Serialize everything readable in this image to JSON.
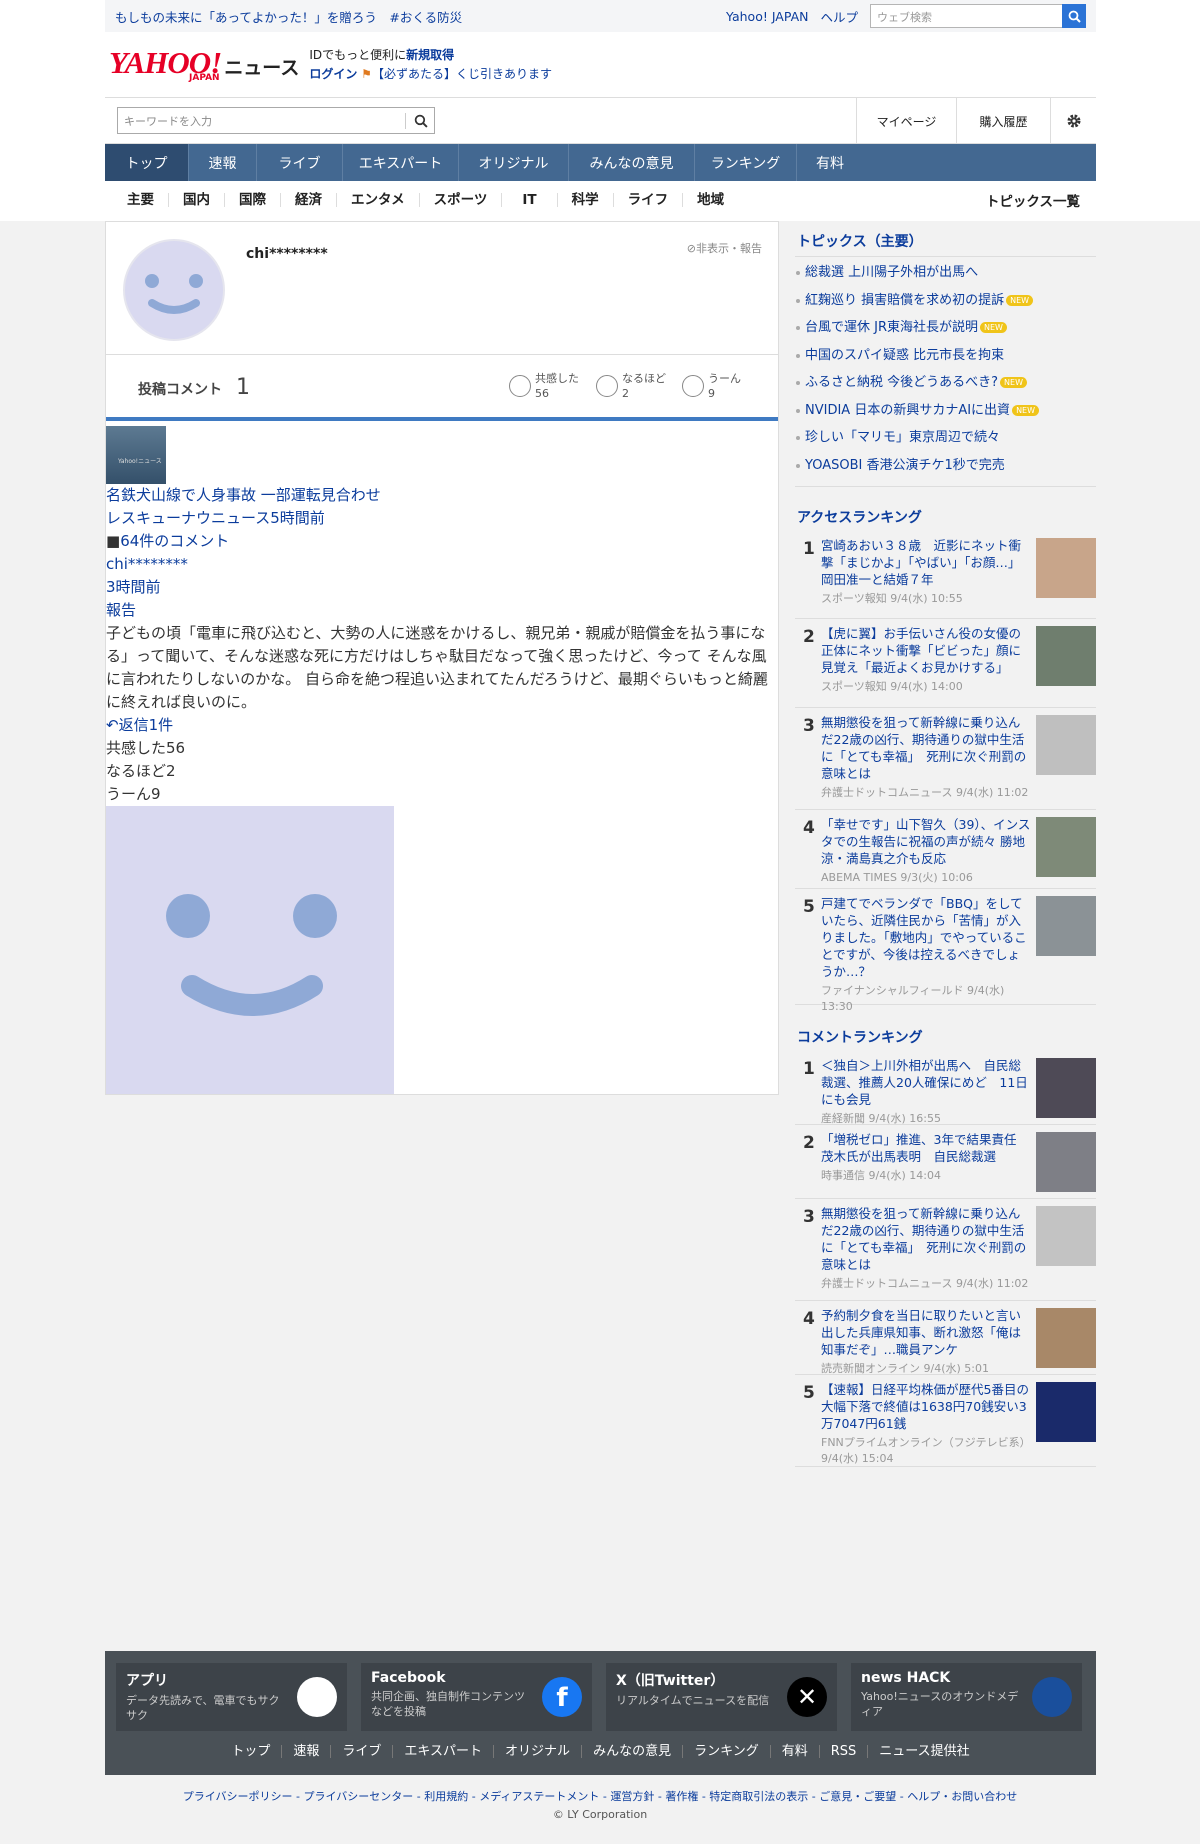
{
  "top": {
    "campaign": "もしもの未来に「あってよかった！」を贈ろう　#おくる防災",
    "yahoo": "Yahoo! JAPAN",
    "help": "ヘルプ",
    "search_placeholder": "ウェブ検索"
  },
  "logo": {
    "brand": "YAHOO!",
    "sub": "JAPAN",
    "news": "ニュース"
  },
  "login": {
    "line1_pre": "IDでもっと便利に",
    "line1_link": "新規取得",
    "line2_link": "ログイン",
    "line2_text": "【必ずあたる】くじ引きあります"
  },
  "search": {
    "placeholder": "キーワードを入力",
    "mypage": "マイページ",
    "history": "購入履歴"
  },
  "nav": [
    "トップ",
    "速報",
    "ライブ",
    "エキスパート",
    "オリジナル",
    "みんなの意見",
    "ランキング",
    "有料"
  ],
  "subnav": [
    "主要",
    "国内",
    "国際",
    "経済",
    "エンタメ",
    "スポーツ",
    "IT",
    "科学",
    "ライフ",
    "地域"
  ],
  "subnav_all": "トピックス一覧",
  "profile": {
    "username": "chi********",
    "hide_report": "非表示・報告",
    "posted_label": "投稿コメント",
    "posted_count": "1",
    "reactions": [
      {
        "label": "共感した",
        "count": "56"
      },
      {
        "label": "なるほど",
        "count": "2"
      },
      {
        "label": "うーん",
        "count": "9"
      }
    ]
  },
  "article": {
    "thumb_text": "Yahoo!ニュース",
    "title": "名鉄犬山線で人身事故 一部運転見合わせ",
    "source_time": "レスキューナウニュース5時間前",
    "comments": "64件のコメント",
    "user": "chi********",
    "time": "3時間前",
    "report": "報告",
    "body": "子どもの頃「電車に飛び込むと、大勢の人に迷惑をかけるし、親兄弟・親戚が賠償金を払う事になる」って聞いて、そんな迷惑な死に方だけはしちゃ駄目だなって強く思ったけど、今って そんな風に言われたりしないのかな。 自ら命を絶つ程追い込まれてたんだろうけど、最期ぐらいもっと綺麗に終えれば良いのに。",
    "replies": "返信1件",
    "empathy": "共感した56",
    "naruhodo": "なるほど2",
    "uun": "うーん9"
  },
  "topics": {
    "title": "トピックス（主要）",
    "items": [
      {
        "t": "総裁選 上川陽子外相が出馬へ",
        "new": ""
      },
      {
        "t": "紅麹巡り 損害賠償を求め初の提訴",
        "new": "NEW"
      },
      {
        "t": "台風で運休 JR東海社長が説明",
        "new": "NEW"
      },
      {
        "t": "中国のスパイ疑惑 比元市長を拘束",
        "new": ""
      },
      {
        "t": "ふるさと納税 今後どうあるべき?",
        "new": "NEW"
      },
      {
        "t": "NVIDIA 日本の新興サカナAIに出資",
        "new": "NEW"
      },
      {
        "t": "珍しい「マリモ」東京周辺で続々",
        "new": ""
      },
      {
        "t": "YOASOBI 香港公演チケ1秒で完売",
        "new": ""
      }
    ]
  },
  "access": {
    "title": "アクセスランキング",
    "items": [
      {
        "n": "1",
        "t": "宮崎あおい３８歳　近影にネット衝撃「まじかよ」「やばい」「お顔…」岡田准一と結婚７年",
        "s": "スポーツ報知 9/4(水) 10:55"
      },
      {
        "n": "2",
        "t": "【虎に翼】お手伝いさん役の女優の正体にネット衝撃「ビビった」顔に見覚え「最近よくお見かけする」",
        "s": "スポーツ報知 9/4(水) 14:00"
      },
      {
        "n": "3",
        "t": "無期懲役を狙って新幹線に乗り込んだ22歳の凶行、期待通りの獄中生活に「とても幸福」　死刑に次ぐ刑罰の意味とは",
        "s": "弁護士ドットコムニュース 9/4(水) 11:02"
      },
      {
        "n": "4",
        "t": "「幸せです」山下智久（39）、インスタでの生報告に祝福の声が続々 勝地涼・満島真之介も反応",
        "s": "ABEMA TIMES 9/3(火) 10:06"
      },
      {
        "n": "5",
        "t": "戸建てでベランダで「BBQ」をしていたら、近隣住民から「苦情」が入りました。「敷地内」でやっていることですが、今後は控えるべきでしょうか…？",
        "s": "ファイナンシャルフィールド 9/4(水) 13:30"
      }
    ]
  },
  "comment_rank": {
    "title": "コメントランキング",
    "items": [
      {
        "n": "1",
        "t": "＜独自＞上川外相が出馬へ　自民総裁選、推薦人20人確保にめど　11日にも会見",
        "s": "産経新聞 9/4(水) 16:55"
      },
      {
        "n": "2",
        "t": "「増税ゼロ」推進、3年で結果責任　茂木氏が出馬表明　自民総裁選",
        "s": "時事通信 9/4(水) 14:04"
      },
      {
        "n": "3",
        "t": "無期懲役を狙って新幹線に乗り込んだ22歳の凶行、期待通りの獄中生活に「とても幸福」　死刑に次ぐ刑罰の意味とは",
        "s": "弁護士ドットコムニュース 9/4(水) 11:02"
      },
      {
        "n": "4",
        "t": "予約制夕食を当日に取りたいと言い出した兵庫県知事、断れ激怒「俺は知事だぞ」…職員アンケ",
        "s": "読売新聞オンライン 9/4(水) 5:01"
      },
      {
        "n": "5",
        "t": "【速報】日経平均株価が歴代5番目の大幅下落で終値は1638円70銭安い3万7047円61銭",
        "s": "FNNプライムオンライン（フジテレビ系） 9/4(水) 15:04"
      }
    ]
  },
  "footer": {
    "cards": [
      {
        "t": "アプリ",
        "d": "データ先読みで、電車でもサクサク"
      },
      {
        "t": "Facebook",
        "d": "共同企画、独自制作コンテンツなどを投稿"
      },
      {
        "t": "X（旧Twitter）",
        "d": "リアルタイムでニュースを配信"
      },
      {
        "t": "news HACK",
        "d": "Yahoo!ニュースのオウンドメディア"
      }
    ],
    "nav": [
      "トップ",
      "速報",
      "ライブ",
      "エキスパート",
      "オリジナル",
      "みんなの意見",
      "ランキング",
      "有料",
      "RSS",
      "ニュース提供社"
    ],
    "legal": "プライバシーポリシー - プライバシーセンター - 利用規約 - メディアステートメント - 運営方針 - 著作権 - 特定商取引法の表示 - ご意見・ご要望 - ヘルプ・お問い合わせ",
    "copy": "© LY Corporation"
  },
  "colors": {
    "nav": "#436891",
    "accent": "#0b3c9c",
    "brand": "#e60026"
  }
}
